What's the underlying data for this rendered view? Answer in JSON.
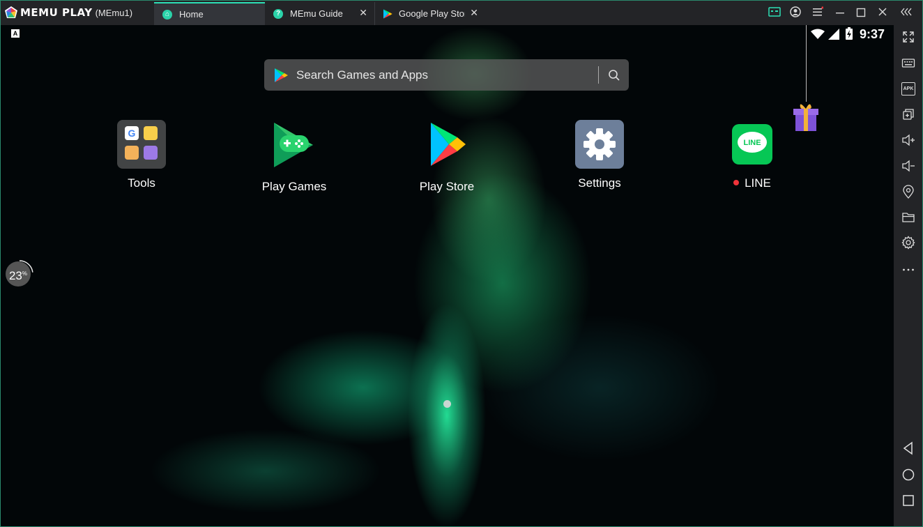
{
  "titlebar": {
    "app_name": "MEMU PLAY",
    "instance": "(MEmu1)",
    "tabs": [
      {
        "label": "Home",
        "icon": "home-icon"
      },
      {
        "label": "MEmu Guide",
        "icon": "help-icon",
        "close": "✕"
      },
      {
        "label": "Google Play Store",
        "icon": "play-store-icon",
        "close": "✕"
      }
    ],
    "controls": [
      "keyboard-mapping-icon",
      "account-icon",
      "menu-icon",
      "minimize-icon",
      "maximize-icon",
      "close-icon",
      "collapse-sidebar-icon"
    ]
  },
  "status_bar": {
    "indicator": "A",
    "time": "9:37"
  },
  "search": {
    "placeholder": "Search Games and Apps"
  },
  "apps": [
    {
      "label": "Tools",
      "icon": "tools-folder-icon"
    },
    {
      "label": "Play Games",
      "icon": "play-games-icon"
    },
    {
      "label": "Play Store",
      "icon": "play-store-icon"
    },
    {
      "label": "Settings",
      "icon": "settings-gear-icon"
    },
    {
      "label": "LINE",
      "icon": "line-app-icon",
      "new_badge": true
    }
  ],
  "progress": {
    "value": "23",
    "unit": "%",
    "fraction": 0.23
  },
  "sidebar": {
    "top_buttons": [
      "fullscreen-icon",
      "keyboard-icon",
      "apk-install-icon",
      "multi-instance-icon",
      "volume-up-icon",
      "volume-down-icon",
      "location-icon",
      "shared-folder-icon",
      "settings-icon",
      "more-icon"
    ],
    "apk_label": "APK",
    "bottom_buttons": [
      "back-icon",
      "home-icon",
      "recents-icon"
    ]
  },
  "colors": {
    "accent": "#2de0b5",
    "titlebar_bg": "#232427",
    "badge_red": "#f0333a"
  }
}
